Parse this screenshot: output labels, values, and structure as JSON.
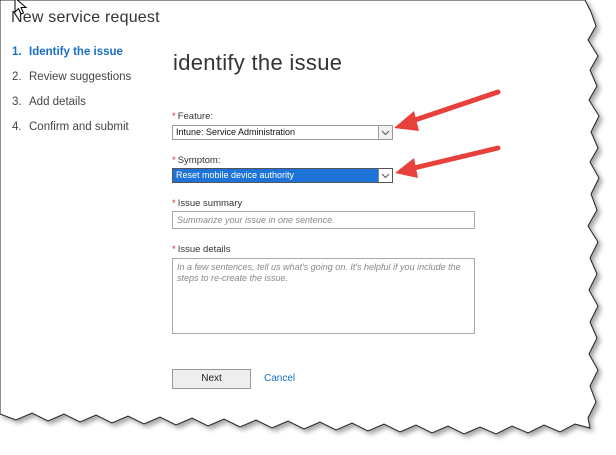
{
  "window": {
    "title": "New service request"
  },
  "steps": [
    {
      "num": "1.",
      "label": "Identify the issue"
    },
    {
      "num": "2.",
      "label": "Review suggestions"
    },
    {
      "num": "3.",
      "label": "Add details"
    },
    {
      "num": "4.",
      "label": "Confirm and submit"
    }
  ],
  "form": {
    "heading": "identify the issue",
    "required_marker": "*",
    "feature": {
      "label": "Feature:",
      "value": "Intune: Service Administration"
    },
    "symptom": {
      "label": "Symptom:",
      "value": "Reset mobile device authority"
    },
    "summary": {
      "label": "Issue summary",
      "placeholder": "Summarize your issue in one sentence."
    },
    "details": {
      "label": "Issue details",
      "placeholder": "In a few sentences, tell us what's going on. It's helpful if you include the steps to re-create the issue."
    },
    "next_label": "Next",
    "cancel_label": "Cancel"
  },
  "icons": {
    "cursor": "mouse-pointer-icon",
    "dropdown": "chevron-down-icon",
    "annotation": "red-arrow"
  },
  "colors": {
    "accent": "#1a6fc4",
    "selected_bg": "#1e73d8",
    "required": "#d03030",
    "annotation_arrow": "#e8413c"
  }
}
